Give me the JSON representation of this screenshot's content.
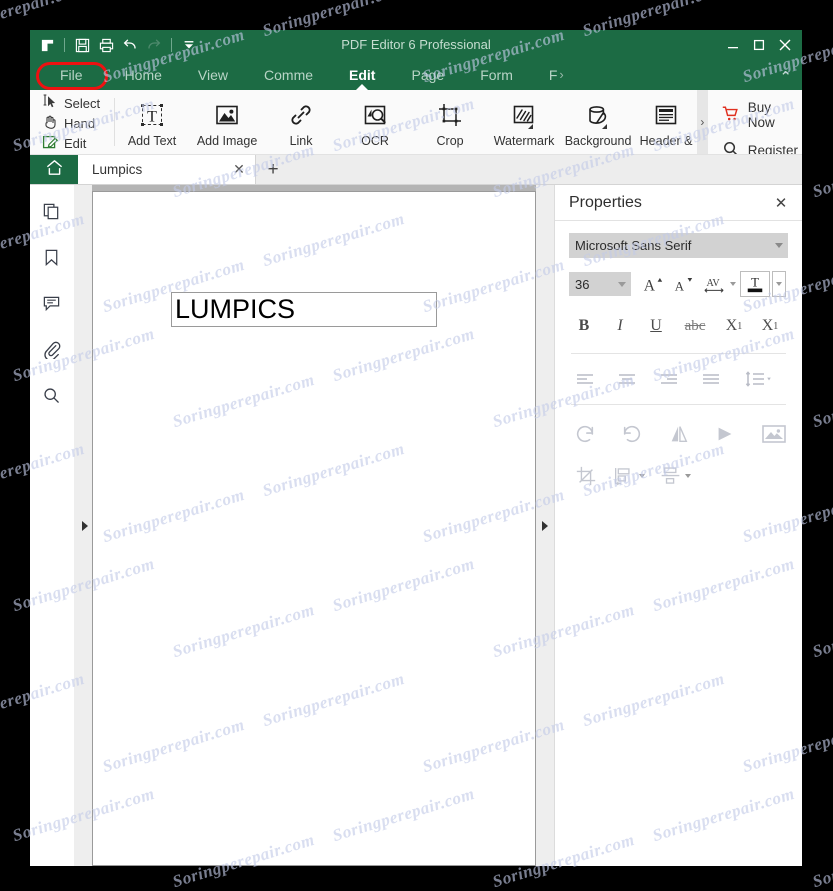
{
  "window": {
    "title": "PDF Editor 6 Professional",
    "accent_color": "#1c6b44",
    "highlight_color": "#ee1111",
    "minimize_label": "—",
    "maximize_label": "☐",
    "close_label": "✕"
  },
  "quick_access": {
    "items": [
      {
        "name": "app-menu-icon",
        "label": "App Menu"
      },
      {
        "name": "save-icon",
        "label": "Save"
      },
      {
        "name": "print-icon",
        "label": "Print"
      },
      {
        "name": "undo-icon",
        "label": "Undo"
      },
      {
        "name": "redo-icon",
        "label": "Redo"
      },
      {
        "name": "customize-qat-icon",
        "label": "Customize Quick Access Toolbar"
      }
    ]
  },
  "ribbon_tabs": {
    "items": [
      {
        "label": "File",
        "active": false,
        "highlighted": true
      },
      {
        "label": "Home",
        "active": false,
        "highlighted": false
      },
      {
        "label": "View",
        "active": false,
        "highlighted": false
      },
      {
        "label": "Comme",
        "active": false,
        "highlighted": false
      },
      {
        "label": "Edit",
        "active": true,
        "highlighted": false
      },
      {
        "label": "Page",
        "active": false,
        "highlighted": false
      },
      {
        "label": "Form",
        "active": false,
        "highlighted": false
      },
      {
        "label": "F",
        "active": false,
        "highlighted": false
      }
    ],
    "more_indicator": "›",
    "collapse_label": "⌃"
  },
  "ribbon": {
    "small_tools": [
      {
        "label": "Select",
        "icon": "cursor-arrow-icon"
      },
      {
        "label": "Hand",
        "icon": "hand-icon"
      },
      {
        "label": "Edit",
        "icon": "pencil-edit-icon"
      }
    ],
    "tools": [
      {
        "label": "Add Text",
        "icon": "add-text-icon",
        "dropdown": false
      },
      {
        "label": "Add Image",
        "icon": "add-image-icon",
        "dropdown": false
      },
      {
        "label": "Link",
        "icon": "link-icon",
        "dropdown": false
      },
      {
        "label": "OCR",
        "icon": "ocr-icon",
        "dropdown": false
      },
      {
        "label": "Crop",
        "icon": "crop-icon",
        "dropdown": false
      },
      {
        "label": "Watermark",
        "icon": "watermark-icon",
        "dropdown": true
      },
      {
        "label": "Background",
        "icon": "background-icon",
        "dropdown": true
      },
      {
        "label": "Header &",
        "icon": "header-footer-icon",
        "dropdown": false
      }
    ],
    "overflow_label": "›",
    "purchase": [
      {
        "label": "Buy Now",
        "icon": "cart-icon",
        "color": "#e03020"
      },
      {
        "label": "Register",
        "icon": "search-key-icon",
        "color": "#333333"
      }
    ]
  },
  "tabstrip": {
    "home_icon": "home-icon",
    "documents": [
      {
        "label": "Lumpics",
        "active": true,
        "close_label": "✕"
      }
    ],
    "add_label": "+"
  },
  "left_rail": {
    "items": [
      {
        "name": "thumbnails-icon",
        "label": "Page Thumbnails"
      },
      {
        "name": "bookmark-icon",
        "label": "Bookmarks"
      },
      {
        "name": "comment-icon",
        "label": "Comments"
      },
      {
        "name": "attachment-icon",
        "label": "Attachments"
      },
      {
        "name": "search-icon",
        "label": "Search"
      }
    ]
  },
  "document": {
    "text_object": "LUMPICS"
  },
  "properties": {
    "title": "Properties",
    "close_label": "✕",
    "font_family": "Microsoft Sans Serif",
    "font_size": "36",
    "font_buttons": [
      {
        "name": "increase-font-size-icon",
        "label": "A▴"
      },
      {
        "name": "decrease-font-size-icon",
        "label": "A▾"
      },
      {
        "name": "character-spacing-icon",
        "label": "AV"
      },
      {
        "name": "font-color-icon",
        "label": "T"
      }
    ],
    "style_buttons": [
      {
        "name": "bold-button",
        "label": "B"
      },
      {
        "name": "italic-button",
        "label": "I"
      },
      {
        "name": "underline-button",
        "label": "U"
      },
      {
        "name": "strikethrough-button",
        "label": "abc"
      },
      {
        "name": "superscript-button",
        "label": "X"
      },
      {
        "name": "subscript-button",
        "label": "X"
      }
    ],
    "align_buttons": [
      {
        "name": "align-left-button",
        "label": "Align Left"
      },
      {
        "name": "align-center-button",
        "label": "Align Center"
      },
      {
        "name": "align-right-button",
        "label": "Align Right"
      },
      {
        "name": "align-justify-button",
        "label": "Justify"
      },
      {
        "name": "line-spacing-button",
        "label": "Line Spacing"
      }
    ],
    "transform_buttons": [
      {
        "name": "rotate-left-button",
        "label": "Rotate Left"
      },
      {
        "name": "rotate-right-button",
        "label": "Rotate Right"
      },
      {
        "name": "flip-vertical-button",
        "label": "Flip Vertical"
      },
      {
        "name": "flip-horizontal-button",
        "label": "Flip Horizontal"
      },
      {
        "name": "replace-image-button",
        "label": "Replace Image"
      },
      {
        "name": "crop-image-button",
        "label": "Crop Image"
      },
      {
        "name": "align-objects-button",
        "label": "Align Objects"
      },
      {
        "name": "distribute-objects-button",
        "label": "Distribute Objects"
      }
    ]
  },
  "watermark": {
    "text": "Soringperepair.com"
  }
}
